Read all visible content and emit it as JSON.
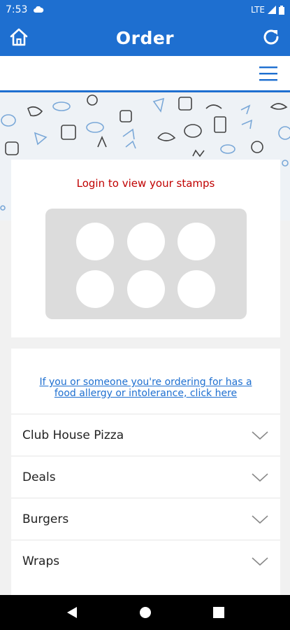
{
  "status_bar": {
    "time": "7:53",
    "network": "LTE"
  },
  "app_bar": {
    "title": "Order"
  },
  "stamps": {
    "login_text": "Login to view your stamps",
    "collected": 0,
    "total": 6
  },
  "menu": {
    "allergy_line1": "If you or someone you're ordering for has a",
    "allergy_line2": "food allergy or intolerance, click here",
    "categories": [
      {
        "label": "Club House Pizza"
      },
      {
        "label": "Deals"
      },
      {
        "label": "Burgers"
      },
      {
        "label": "Wraps"
      }
    ]
  },
  "icons": {
    "home": "home-icon",
    "refresh": "refresh-icon",
    "menu": "hamburger-icon",
    "chevron": "chevron-down-icon"
  },
  "colors": {
    "brand": "#1e6fd0",
    "login_text": "#c00000",
    "stamp_board": "#dcdcdc"
  }
}
